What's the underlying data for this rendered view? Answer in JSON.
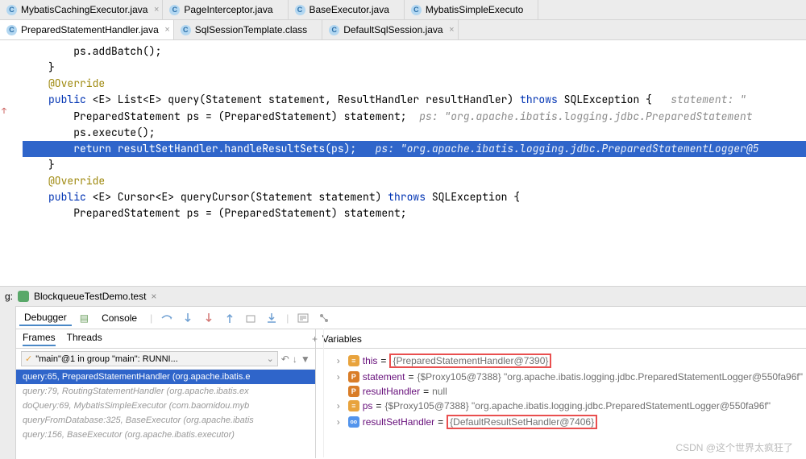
{
  "tabs_row1": [
    {
      "icon": "C",
      "label": "MybatisCachingExecutor.java",
      "close": true
    },
    {
      "icon": "C",
      "label": "PageInterceptor.java"
    },
    {
      "icon": "C",
      "label": "BaseExecutor.java"
    },
    {
      "icon": "C",
      "label": "MybatisSimpleExecuto"
    }
  ],
  "tabs_row2": [
    {
      "icon": "C",
      "label": "PreparedStatementHandler.java",
      "close": true,
      "active": true
    },
    {
      "icon": "C",
      "label": "SqlSessionTemplate.class"
    },
    {
      "icon": "C",
      "label": "DefaultSqlSession.java",
      "close": true
    }
  ],
  "code": {
    "l1": "    ps.addBatch();",
    "l2": "}",
    "l3": "",
    "ann": "@Override",
    "l4_pre": "public ",
    "l4_gen": "<E> List<E> ",
    "l4_m": "query(Statement statement, ResultHandler resultHandler) ",
    "l4_throws": "throws ",
    "l4_ex": "SQLException {",
    "l4_hint": "   statement: \"",
    "l5_a": "    PreparedStatement ps = (PreparedStatement) statement;",
    "l5_hint": "  ps: \"org.apache.ibatis.logging.jdbc.PreparedStatement",
    "l6": "    ps.execute();",
    "hl_a": "    return ",
    "hl_b": "resultSetHandler.handleResultSets(ps);",
    "hl_hint": "   ps: \"org.apache.ibatis.logging.jdbc.PreparedStatementLogger@5",
    "l8": "}",
    "l9": "",
    "ann2": "@Override",
    "l10_pre": "public ",
    "l10_gen": "<E> Cursor<E> ",
    "l10_m": "queryCursor(Statement statement) ",
    "l10_throws": "throws ",
    "l10_ex": "SQLException {",
    "l11": "    PreparedStatement ps = (PreparedStatement) statement;"
  },
  "debug": {
    "label_g": "g:",
    "config": "BlockqueueTestDemo.test",
    "tabs": {
      "debugger": "Debugger",
      "console": "Console"
    },
    "frames_tabs": {
      "frames": "Frames",
      "threads": "Threads"
    },
    "vars_label": "Variables",
    "thread": "\"main\"@1 in group \"main\": RUNNI...",
    "stack": [
      {
        "txt": "query:65, PreparedStatementHandler (org.apache.ibatis.e",
        "sel": true
      },
      {
        "txt": "query:79, RoutingStatementHandler (org.apache.ibatis.ex"
      },
      {
        "txt": "doQuery:69, MybatisSimpleExecutor (com.baomidou.myb"
      },
      {
        "txt": "queryFromDatabase:325, BaseExecutor (org.apache.ibatis"
      },
      {
        "txt": "query:156, BaseExecutor (org.apache.ibatis.executor)"
      }
    ],
    "vars": [
      {
        "exp": "›",
        "badge": "≡",
        "bcls": "b-yellow",
        "name": "this",
        "eq": " = ",
        "val": "{PreparedStatementHandler@7390}",
        "box": "val"
      },
      {
        "exp": "›",
        "badge": "P",
        "bcls": "b-orange",
        "name": "statement",
        "eq": " = ",
        "val": "{$Proxy105@7388} \"org.apache.ibatis.logging.jdbc.PreparedStatementLogger@550fa96f\""
      },
      {
        "exp": "",
        "badge": "P",
        "bcls": "b-orange",
        "name": "resultHandler",
        "eq": " = ",
        "val": "null"
      },
      {
        "exp": "›",
        "badge": "≡",
        "bcls": "b-yellow",
        "name": "ps",
        "eq": " = ",
        "val": "{$Proxy105@7388} \"org.apache.ibatis.logging.jdbc.PreparedStatementLogger@550fa96f\""
      },
      {
        "exp": "›",
        "badge": "oo",
        "bcls": "b-blue",
        "name": "resultSetHandler",
        "eq": " = ",
        "val": "{DefaultResultSetHandler@7406}",
        "box": "val"
      }
    ]
  },
  "watermark": "CSDN @这个世界太疯狂了"
}
